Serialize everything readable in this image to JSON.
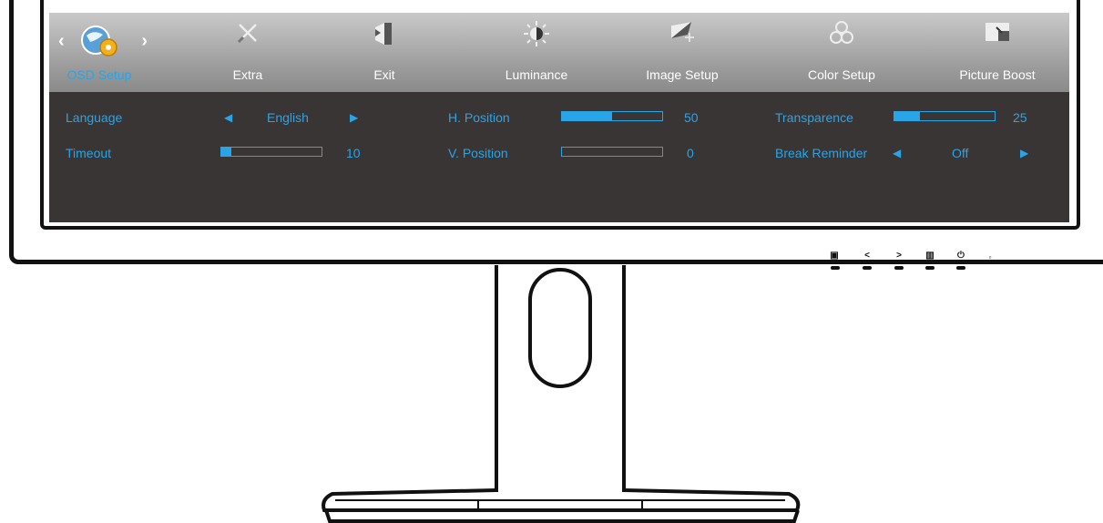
{
  "tabs": [
    {
      "label": "OSD Setup",
      "icon": "osd-setup-icon",
      "active": true
    },
    {
      "label": "Extra",
      "icon": "extra-tools-icon"
    },
    {
      "label": "Exit",
      "icon": "exit-icon"
    },
    {
      "label": "Luminance",
      "icon": "luminance-icon"
    },
    {
      "label": "Image Setup",
      "icon": "image-setup-icon"
    },
    {
      "label": "Color Setup",
      "icon": "color-setup-icon"
    },
    {
      "label": "Picture Boost",
      "icon": "picture-boost-icon"
    }
  ],
  "settings": {
    "language": {
      "label": "Language",
      "value": "English"
    },
    "timeout": {
      "label": "Timeout",
      "value": "10",
      "level": 0.1
    },
    "h_position": {
      "label": "H. Position",
      "value": "50",
      "level": 0.5
    },
    "v_position": {
      "label": "V. Position",
      "value": "0",
      "level": 0
    },
    "transparence": {
      "label": "Transparence",
      "value": "25",
      "level": 0.25
    },
    "break_reminder": {
      "label": "Break Reminder",
      "value": "Off"
    }
  },
  "colors": {
    "accent": "#29a4e6",
    "panel": "#3a3535"
  },
  "buttons": [
    {
      "icon": "source-icon"
    },
    {
      "icon": "left-arrow-icon",
      "label": "<"
    },
    {
      "icon": "right-arrow-icon",
      "label": ">"
    },
    {
      "icon": "menu-icon"
    },
    {
      "icon": "power-icon"
    },
    {
      "icon": "power-led-icon"
    }
  ]
}
